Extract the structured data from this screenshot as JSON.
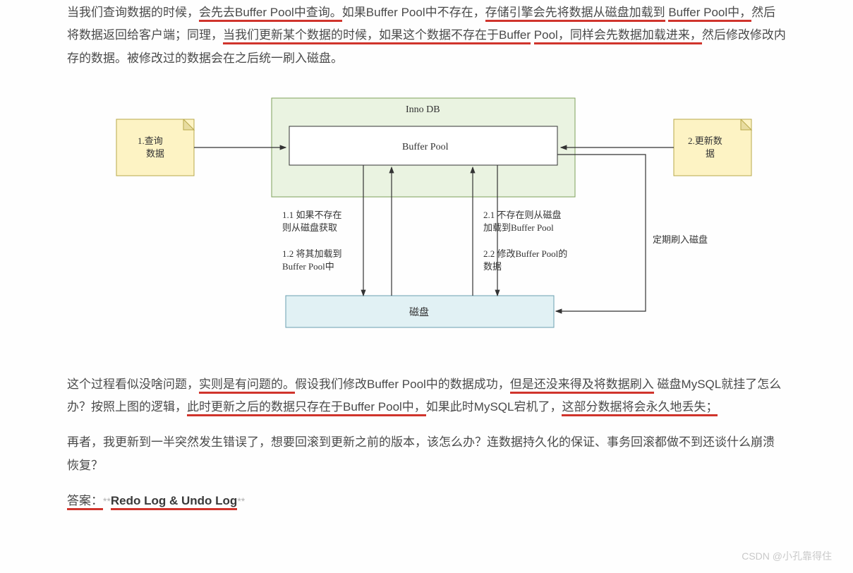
{
  "para1": {
    "t1": "当我们查询数据的时候，",
    "t2": "会先去Buffer Pool中查询。",
    "t3": "如果Buffer Pool中不存在，",
    "t4": "存储引擎会先将数据从磁盘加载到",
    "t5": "Buffer Pool中，",
    "t6": "然后将数据返回给客户端；同理，",
    "t7": "当我们更新某个数据的时候，",
    "t8": "如果这个数据不存在于Buffer",
    "t9": "Pool，同样会先数据加载进来，",
    "t10": "然后修改修改内存的数据。被修改过的数据会在之后统一刷入磁盘。"
  },
  "diagram": {
    "note_left_1": "1.查询",
    "note_left_2": "数据",
    "note_right_1": "2.更新数",
    "note_right_2": "据",
    "innodb": "Inno DB",
    "buffer": "Buffer Pool",
    "disk": "磁盘",
    "lbl_11a": "1.1 如果不存在",
    "lbl_11b": "则从磁盘获取",
    "lbl_12a": "1.2 将其加载到",
    "lbl_12b": "Buffer Pool中",
    "lbl_21a": "2.1 不存在则从磁盘",
    "lbl_21b": "加载到Buffer Pool",
    "lbl_22a": "2.2 修改Buffer Pool的",
    "lbl_22b": "数据",
    "lbl_flush": "定期刷入磁盘"
  },
  "para2": {
    "t1": "这个过程看似没啥问题，",
    "t2": "实则是有问题的。",
    "t3": "假设我们修改Buffer Pool中的数据成功，",
    "t4": "但是还没来得及将数据刷入",
    "t5": "磁盘MySQL就挂了怎么办？按照上图的逻辑，",
    "t6": "此时更新之后的数据只存在于Buffer Pool中，",
    "t7": "如果此时MySQL宕机了，",
    "t8": "这部分数据将会永久地丢失；"
  },
  "para3": "再者，我更新到一半突然发生错误了，想要回滚到更新之前的版本，该怎么办？连数据持久化的保证、事务回滚都做不到还谈什么崩溃恢复？",
  "answer": {
    "prefix": "答案：",
    "stars": "**",
    "main": "Redo Log & Undo Log",
    "stars2": "**"
  },
  "watermark": "CSDN @小孔靠得住"
}
